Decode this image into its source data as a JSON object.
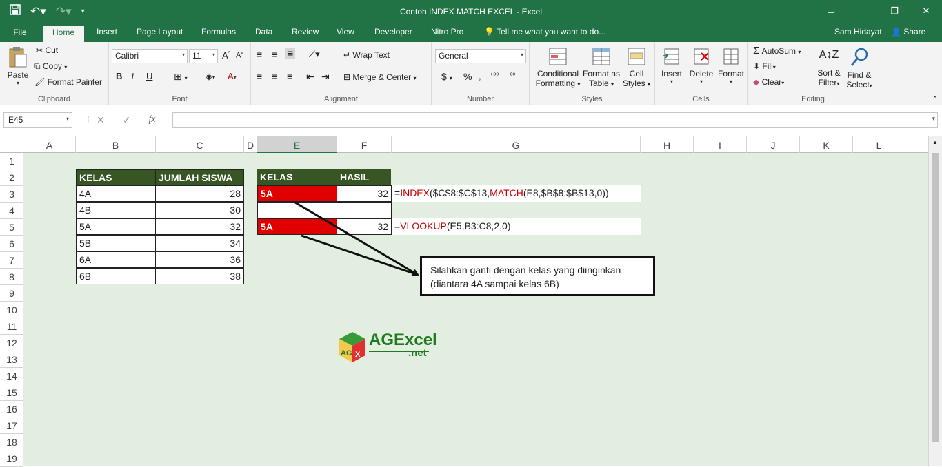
{
  "window": {
    "title": "Contoh INDEX MATCH EXCEL - Excel",
    "user": "Sam Hidayat",
    "share": "Share"
  },
  "tabs": [
    "File",
    "Home",
    "Insert",
    "Page Layout",
    "Formulas",
    "Data",
    "Review",
    "View",
    "Developer",
    "Nitro Pro"
  ],
  "tell_me": "Tell me what you want to do...",
  "ribbon": {
    "clipboard": {
      "label": "Clipboard",
      "paste": "Paste",
      "cut": "Cut",
      "copy": "Copy",
      "format_painter": "Format Painter"
    },
    "font": {
      "label": "Font",
      "name": "Calibri",
      "size": "11",
      "bold": "B",
      "italic": "I",
      "underline": "U"
    },
    "alignment": {
      "label": "Alignment",
      "wrap": "Wrap Text",
      "merge": "Merge & Center"
    },
    "number": {
      "label": "Number",
      "format": "General",
      "currency": "$",
      "percent": "%"
    },
    "styles": {
      "label": "Styles",
      "conditional": "Conditional",
      "conditional2": "Formatting",
      "format_as": "Format as",
      "format_as2": "Table",
      "cell": "Cell",
      "cell2": "Styles"
    },
    "cells": {
      "label": "Cells",
      "insert": "Insert",
      "delete": "Delete",
      "format": "Format"
    },
    "editing": {
      "label": "Editing",
      "autosum": "AutoSum",
      "fill": "Fill",
      "clear": "Clear",
      "sort": "Sort &",
      "sort2": "Filter",
      "find": "Find &",
      "find2": "Select"
    }
  },
  "formula_bar": {
    "name_box": "E45",
    "fx": "fx",
    "value": ""
  },
  "columns": [
    "A",
    "B",
    "C",
    "D",
    "E",
    "F",
    "G",
    "H",
    "I",
    "J",
    "K",
    "L"
  ],
  "rows": [
    "1",
    "2",
    "3",
    "4",
    "5",
    "6",
    "7",
    "8",
    "9",
    "10",
    "11",
    "12",
    "13",
    "14",
    "15",
    "16",
    "17",
    "18",
    "19"
  ],
  "table1": {
    "headers": [
      "KELAS",
      "JUMLAH SISWA"
    ],
    "rows": [
      [
        "4A",
        "28"
      ],
      [
        "4B",
        "30"
      ],
      [
        "5A",
        "32"
      ],
      [
        "5B",
        "34"
      ],
      [
        "6A",
        "36"
      ],
      [
        "6B",
        "38"
      ]
    ]
  },
  "table2": {
    "headers": [
      "KELAS",
      "HASIL"
    ],
    "e3": "5A",
    "f3": "32",
    "e5": "5A",
    "f5": "32"
  },
  "formulas": {
    "g3": {
      "eq": "=",
      "f1": "INDEX",
      "a1": "($C$8:$C$13,",
      "f2": "MATCH",
      "a2": "(E8,$B$8:$B$13,0))"
    },
    "g5": {
      "eq": "=",
      "f1": "VLOOKUP",
      "a1": "(E5,B3:C8,2,0)"
    }
  },
  "callout": {
    "line1": "Silahkan ganti dengan kelas yang diinginkan",
    "line2": "(diantara  4A sampai kelas 6B)"
  },
  "logo": {
    "text": "AGExcel",
    "sub": ".net",
    "badge": "AG"
  },
  "colors": {
    "excel_green": "#217346",
    "header_green": "#375623",
    "red": "#e00000",
    "sheet_bg": "#e2efe0"
  }
}
